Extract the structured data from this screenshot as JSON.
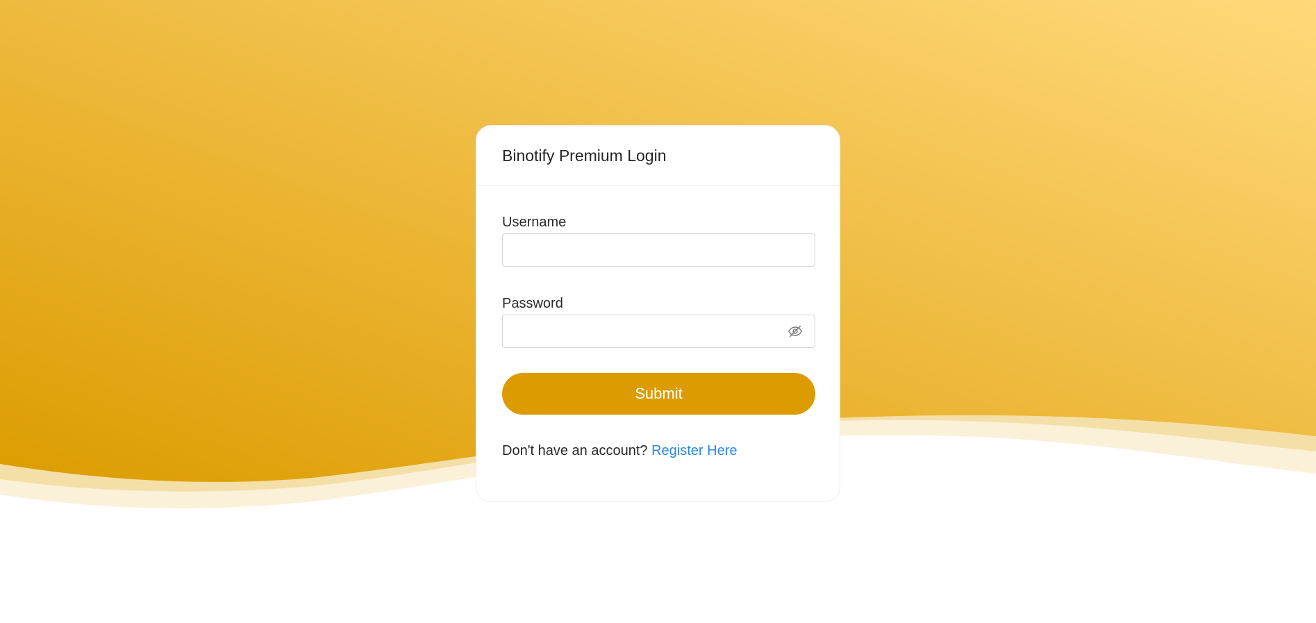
{
  "login": {
    "title": "Binotify Premium Login",
    "username_label": "Username",
    "username_value": "",
    "password_label": "Password",
    "password_value": "",
    "password_toggle_icon": "eye-off-icon",
    "submit_label": "Submit",
    "register_prompt": "Don't have an account?",
    "register_link": "Register Here"
  },
  "colors": {
    "background_gradient_start": "#dc9c00",
    "background_gradient_end": "#ffd97a",
    "button": "#dc9c00",
    "link": "#2b87e3",
    "card": "#ffffff"
  }
}
